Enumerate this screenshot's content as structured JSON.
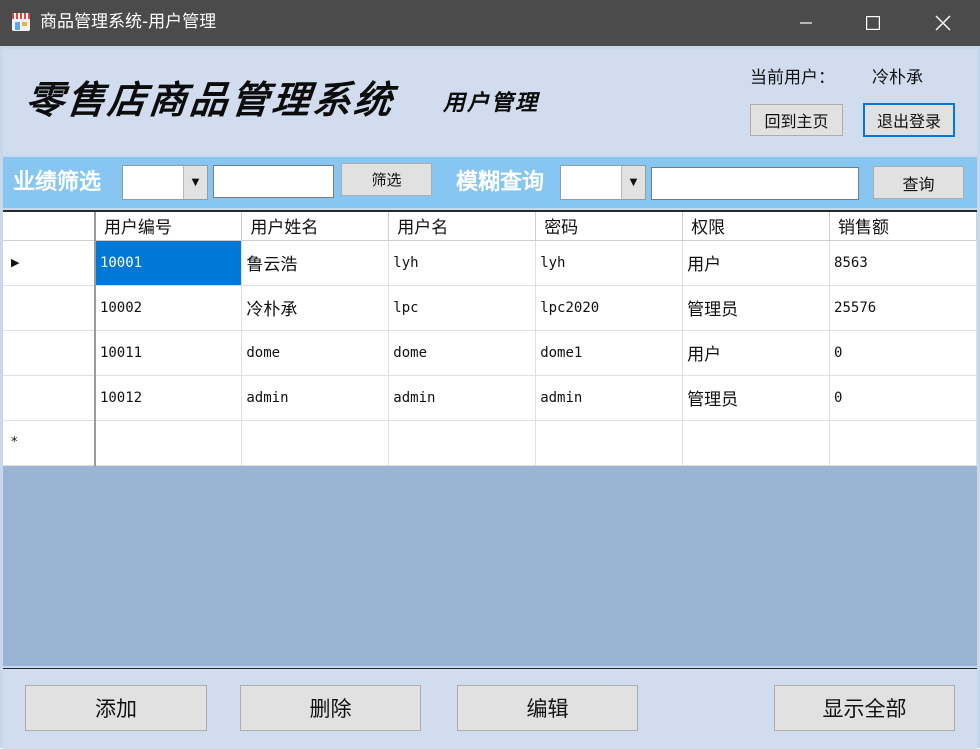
{
  "window": {
    "title": "商品管理系统-用户管理",
    "minimize_label": "minimize",
    "maximize_label": "maximize",
    "close_label": "close"
  },
  "header": {
    "app_title": "零售店商品管理系统",
    "section_title": "用户管理",
    "current_user_label": "当前用户：",
    "current_user_name": "冷朴承",
    "home_button": "回到主页",
    "logout_button": "退出登录"
  },
  "filter": {
    "performance_label": "业绩筛选",
    "filter_button": "筛选",
    "fuzzy_label": "模糊查询",
    "search_button": "查询",
    "performance_combo_value": "",
    "performance_input_value": "",
    "fuzzy_combo_value": "",
    "fuzzy_input_value": ""
  },
  "grid": {
    "columns": [
      "用户编号",
      "用户姓名",
      "用户名",
      "密码",
      "权限",
      "销售额"
    ],
    "current_row_marker": "▶",
    "new_row_marker": "*",
    "rows": [
      [
        "10001",
        "鲁云浩",
        "lyh",
        "lyh",
        "用户",
        "8563"
      ],
      [
        "10002",
        "冷朴承",
        "lpc",
        "lpc2020",
        "管理员",
        "25576"
      ],
      [
        "10011",
        "dome",
        "dome",
        "dome1",
        "用户",
        "0"
      ],
      [
        "10012",
        "admin",
        "admin",
        "admin",
        "管理员",
        "0"
      ]
    ]
  },
  "actions": {
    "add": "添加",
    "delete": "删除",
    "edit": "编辑",
    "show_all": "显示全部"
  },
  "colors": {
    "titlebar": "#4b4b4b",
    "header_bg": "#d1ddee",
    "filter_bg": "#87c6f1",
    "grid_empty_bg": "#99b5d3",
    "selection": "#0078d7"
  }
}
